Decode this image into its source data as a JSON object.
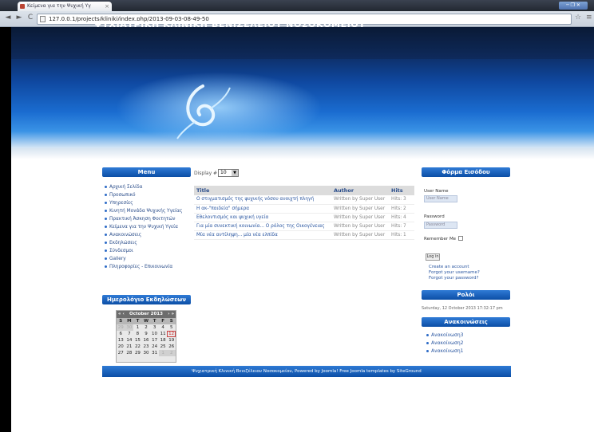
{
  "browser": {
    "tab_title": "Κείμενα για την Ψυχική Υγ",
    "tab_close": "×",
    "window_controls": "─ ❐ ✕",
    "back": "◄",
    "forward": "►",
    "reload": "C",
    "url": "127.0.0.1/projects/kliniki/index.php/2013-09-03-08-49-50",
    "star": "☆",
    "wrench": "≡"
  },
  "site": {
    "title": "ΨΥΧΙΑΤΡΙΚΗ ΚΛΙΝΙΚΗ ΒΕΝΙΖΕΛΕΙΟΥ ΝΟΣΟΚΟΜΕΙΟΥ",
    "footer": "Ψυχιατρική Κλινική Βενιζέλειου Νοσοκομείου, Powered by Joomla! Free Joomla templates by SiteGround"
  },
  "menu": {
    "title": "Menu",
    "items": [
      "Αρχική Σελίδα",
      "Προσωπικό",
      "Υπηρεσίες",
      "Κινητή Μονάδα Ψυχικής Υγείας",
      "Πρακτική Άσκηση Φοιτητών",
      "Κείμενα για την Ψυχική Υγεία",
      "Ανακοινώσεις",
      "Εκδηλώσεις",
      "Σύνδεσμοι",
      "Gallery",
      "Πληροφορίες - Επικοινωνία"
    ]
  },
  "calendar": {
    "title": "Ημερολόγιο Εκδηλώσεων",
    "prev": "« ‹",
    "next": "› »",
    "month": "October 2013",
    "days_of_week": [
      "S",
      "M",
      "T",
      "W",
      "T",
      "F",
      "S"
    ],
    "weeks": [
      [
        "29",
        "30",
        "1",
        "2",
        "3",
        "4",
        "5"
      ],
      [
        "6",
        "7",
        "8",
        "9",
        "10",
        "11",
        "12"
      ],
      [
        "13",
        "14",
        "15",
        "16",
        "17",
        "18",
        "19"
      ],
      [
        "20",
        "21",
        "22",
        "23",
        "24",
        "25",
        "26"
      ],
      [
        "27",
        "28",
        "29",
        "30",
        "31",
        "1",
        "2"
      ]
    ]
  },
  "content": {
    "display_label": "Display #",
    "display_value": "10",
    "columns": {
      "title": "Title",
      "author": "Author",
      "hits": "Hits"
    },
    "rows": [
      {
        "title": "Ο στιγματισμός της ψυχικής νόσου ανοιχτή πληγή",
        "author": "Written by Super User",
        "hits": "Hits: 3"
      },
      {
        "title": "Η ακ-\"παιδεία\" σήμερα",
        "author": "Written by Super User",
        "hits": "Hits: 2"
      },
      {
        "title": "Εθελοντισμός και ψυχική υγεία",
        "author": "Written by Super User",
        "hits": "Hits: 4"
      },
      {
        "title": "Για μία συνεκτική κοινωνία... Ο ρόλος της Οικογένειας",
        "author": "Written by Super User",
        "hits": "Hits: 7"
      },
      {
        "title": "Μία νέα αντίληψη... μία νέα ελπίδα",
        "author": "Written by Super User",
        "hits": "Hits: 1"
      }
    ]
  },
  "login": {
    "title": "Φόρμα Εισόδου",
    "username_label": "User Name",
    "username_placeholder": "User Name",
    "password_label": "Password",
    "password_placeholder": "Password",
    "remember_label": "Remember Me",
    "submit": "Log in",
    "links": [
      "Create an account",
      "Forgot your username?",
      "Forgot your password?"
    ]
  },
  "clock": {
    "title": "Ρολόι",
    "value": "Saturday, 12 October 2013 17:32:17 pm"
  },
  "polls": {
    "title": "Ανακοινώσεις",
    "items": [
      "Ανακοίνωση3",
      "Ανακοίνωση2",
      "Ανακοίνωση1"
    ]
  }
}
